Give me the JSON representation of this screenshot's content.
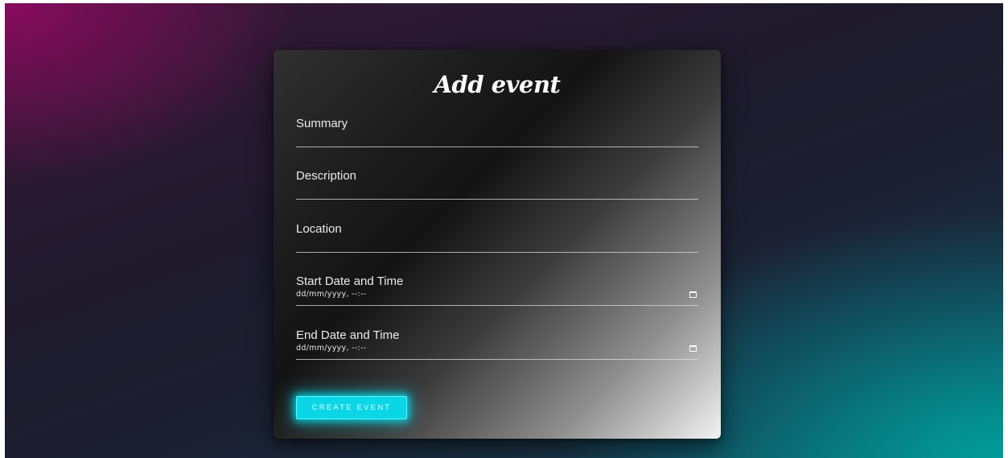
{
  "form": {
    "title": "Add event",
    "fields": {
      "summary": {
        "label": "Summary"
      },
      "description": {
        "label": "Description"
      },
      "location": {
        "label": "Location"
      },
      "start": {
        "label": "Start Date and Time",
        "placeholder": "dd/mm/yyyy, --:--",
        "icon": "calendar-icon"
      },
      "end": {
        "label": "End Date and Time",
        "placeholder": "dd/mm/yyyy, --:--",
        "icon": "calendar-icon"
      }
    },
    "submit_label": "CREATE EVENT"
  },
  "colors": {
    "accent": "#0ad6e6",
    "background_top_left": "#8c0a5f",
    "background_bottom_right": "#00a09b",
    "card_dark": "#141414",
    "card_light": "#f2f2f2"
  }
}
